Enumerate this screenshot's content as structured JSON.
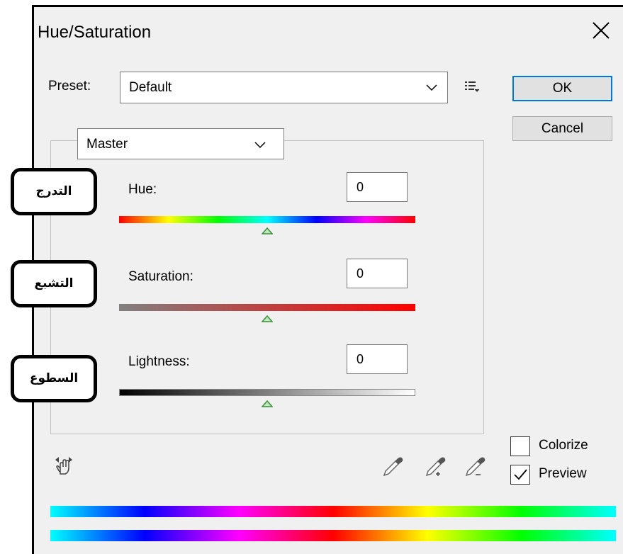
{
  "window": {
    "title": "Hue/Saturation"
  },
  "preset": {
    "label": "Preset:",
    "value": "Default"
  },
  "buttons": {
    "ok": "OK",
    "cancel": "Cancel"
  },
  "channel": {
    "value": "Master"
  },
  "sliders": {
    "hue": {
      "label": "Hue:",
      "value": "0",
      "annotation": "التدرج"
    },
    "saturation": {
      "label": "Saturation:",
      "value": "0",
      "annotation": "التشبع"
    },
    "lightness": {
      "label": "Lightness:",
      "value": "0",
      "annotation": "السطوع"
    }
  },
  "options": {
    "colorize": {
      "label": "Colorize",
      "checked": false
    },
    "preview": {
      "label": "Preview",
      "checked": true
    }
  },
  "icons": {
    "close": "close-icon",
    "preset_menu": "list-menu-icon",
    "on_image": "hand-adjust-icon",
    "eyedroppers": [
      "eyedropper-icon",
      "eyedropper-plus-icon",
      "eyedropper-minus-icon"
    ]
  },
  "colors": {
    "accent": "#0078d7",
    "dialog_bg": "#f0f0f0",
    "thumb": "#3a8f3a"
  }
}
